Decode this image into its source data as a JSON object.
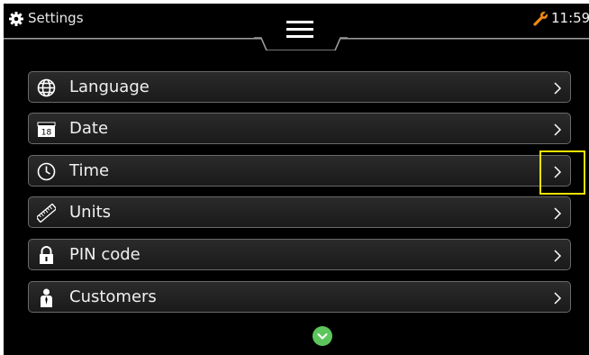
{
  "header": {
    "title": "Settings",
    "time": "11:59",
    "icons": {
      "settings": "gear-icon",
      "menu": "hamburger-menu-icon",
      "service": "wrench-icon"
    }
  },
  "menu": {
    "items": [
      {
        "label": "Language",
        "icon": "globe-icon"
      },
      {
        "label": "Date",
        "icon": "calendar-icon",
        "icon_text": "18"
      },
      {
        "label": "Time",
        "icon": "clock-icon"
      },
      {
        "label": "Units",
        "icon": "ruler-icon"
      },
      {
        "label": "PIN code",
        "icon": "lock-icon"
      },
      {
        "label": "Customers",
        "icon": "person-icon"
      }
    ]
  },
  "colors": {
    "background": "#000000",
    "row_border": "#6a6a6a",
    "text": "#f0f0f0",
    "wrench": "#f08a10",
    "scroll_button": "#5cc65c",
    "highlight": "#f2e300"
  }
}
